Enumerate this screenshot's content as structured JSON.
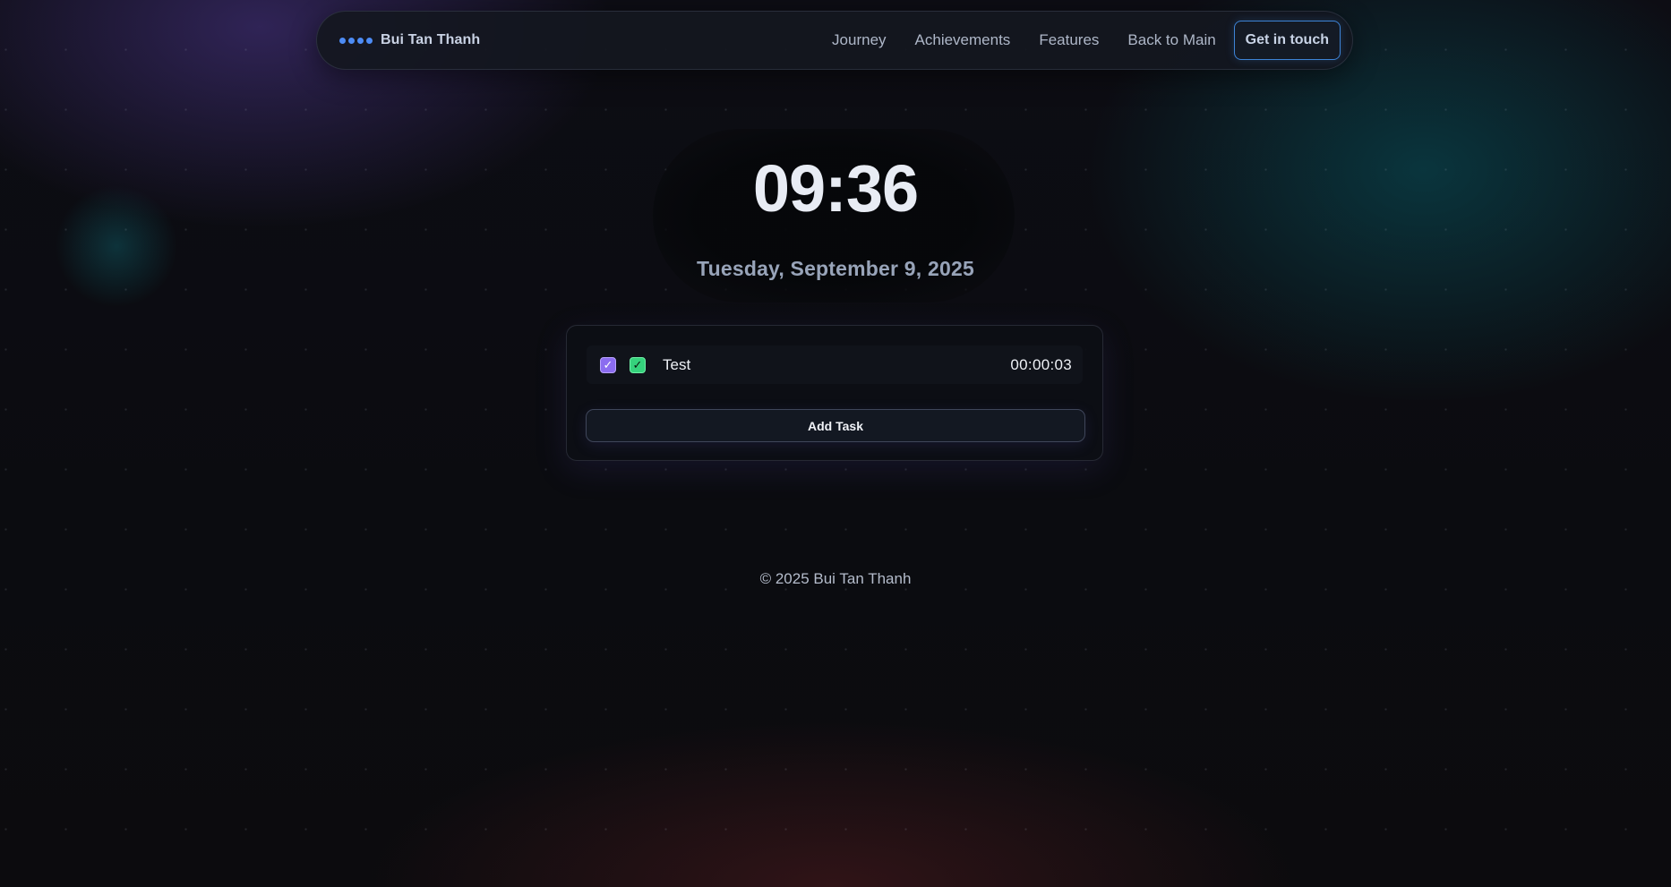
{
  "nav": {
    "brand_name": "Bui Tan Thanh",
    "links": [
      {
        "label": "Journey"
      },
      {
        "label": "Achievements"
      },
      {
        "label": "Features"
      },
      {
        "label": "Back to Main"
      }
    ],
    "cta_label": "Get in touch"
  },
  "clock": {
    "time": "09:36",
    "date": "Tuesday, September 9, 2025"
  },
  "tasks": {
    "items": [
      {
        "name": "Test",
        "timer": "00:00:03",
        "check_primary": "✓",
        "check_done": "✓"
      }
    ],
    "add_label": "Add Task"
  },
  "footer": {
    "text": "© 2025 Bui Tan Thanh"
  },
  "colors": {
    "accent_blue": "#4d8cf5",
    "check_purple": "#8b6cf0",
    "check_green": "#35d27c",
    "background": "#0b0c10"
  }
}
